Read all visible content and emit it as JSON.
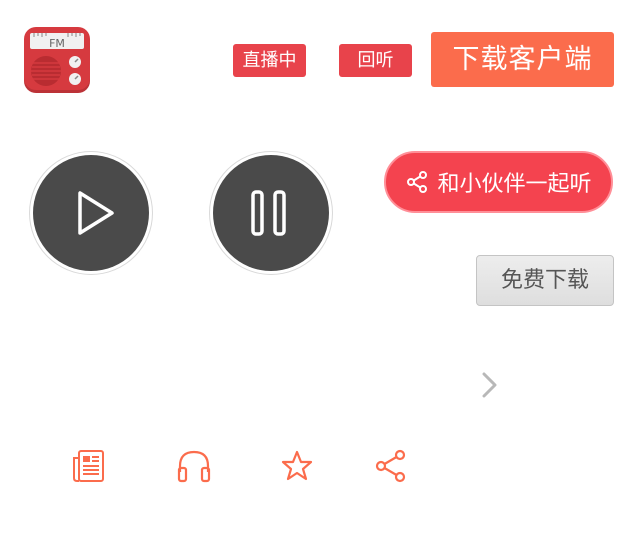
{
  "header": {
    "live_tag": "直播中",
    "replay_tag": "回听",
    "download_client_label": "下载客户端"
  },
  "logo": {
    "text": "FM"
  },
  "player": {
    "play_icon": "play-icon",
    "pause_icon": "pause-icon"
  },
  "share_button": {
    "label": "和小伙伴一起听",
    "icon": "share-icon"
  },
  "free_download_label": "免费下载",
  "toolbar": {
    "icons": [
      "news-icon",
      "headphones-icon",
      "star-icon",
      "share-icon"
    ]
  },
  "colors": {
    "accent_red": "#e8434b",
    "accent_orange": "#fb6c4c",
    "player_dark": "#4a4a4a",
    "toolbar_icon": "#fb6c4c"
  }
}
